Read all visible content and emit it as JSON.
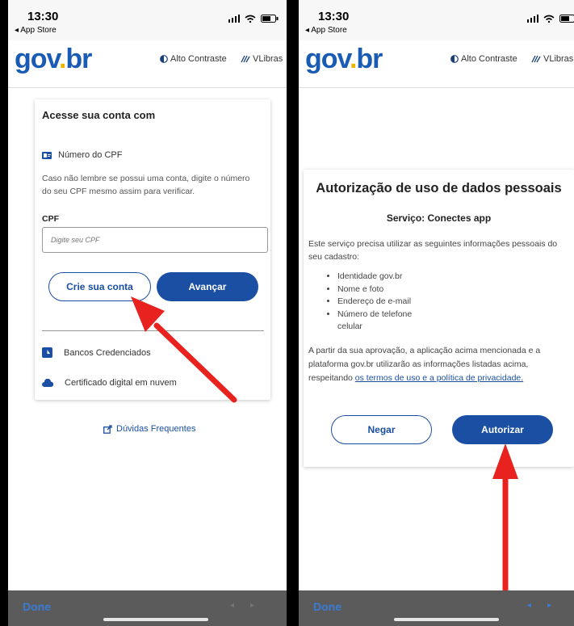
{
  "status": {
    "time": "13:30",
    "back_label": "◂ App Store"
  },
  "header": {
    "logo_part1": "gov",
    "logo_dot": ".",
    "logo_part2": "br",
    "contrast_label": "Alto Contraste",
    "vlibras_label": "VLibras"
  },
  "left": {
    "title": "Acesse sua conta com",
    "cpf_option_label": "Número do CPF",
    "help_text": "Caso não lembre se possui uma conta, digite o número do seu CPF mesmo assim para verificar.",
    "cpf_label": "CPF",
    "cpf_placeholder": "Digite seu CPF",
    "create_account_label": "Crie sua conta",
    "next_label": "Avançar",
    "banks_label": "Bancos Credenciados",
    "cert_label": "Certificado digital em nuvem",
    "faq_label": "Dúvidas Frequentes"
  },
  "right": {
    "title": "Autorização de uso de dados pessoais",
    "service_label": "Serviço: Conectes app",
    "intro_text": "Este serviço precisa utilizar as seguintes informações pessoais do seu cadastro:",
    "items": [
      "Identidade gov.br",
      "Nome e foto",
      "Endereço de e-mail",
      "Número de telefone celular"
    ],
    "approval_text": "A partir da sua aprovação, a aplicação acima mencionada e a plataforma gov.br utilizarão as informações listadas acima, respeitando",
    "terms_link": "os termos de uso e a política de privacidade.",
    "deny_label": "Negar",
    "authorize_label": "Autorizar"
  },
  "toolbar": {
    "done_label": "Done"
  },
  "colors": {
    "brand_blue": "#1a4fa3",
    "brand_yellow": "#f1b400",
    "arrow_red": "#e8231f"
  }
}
